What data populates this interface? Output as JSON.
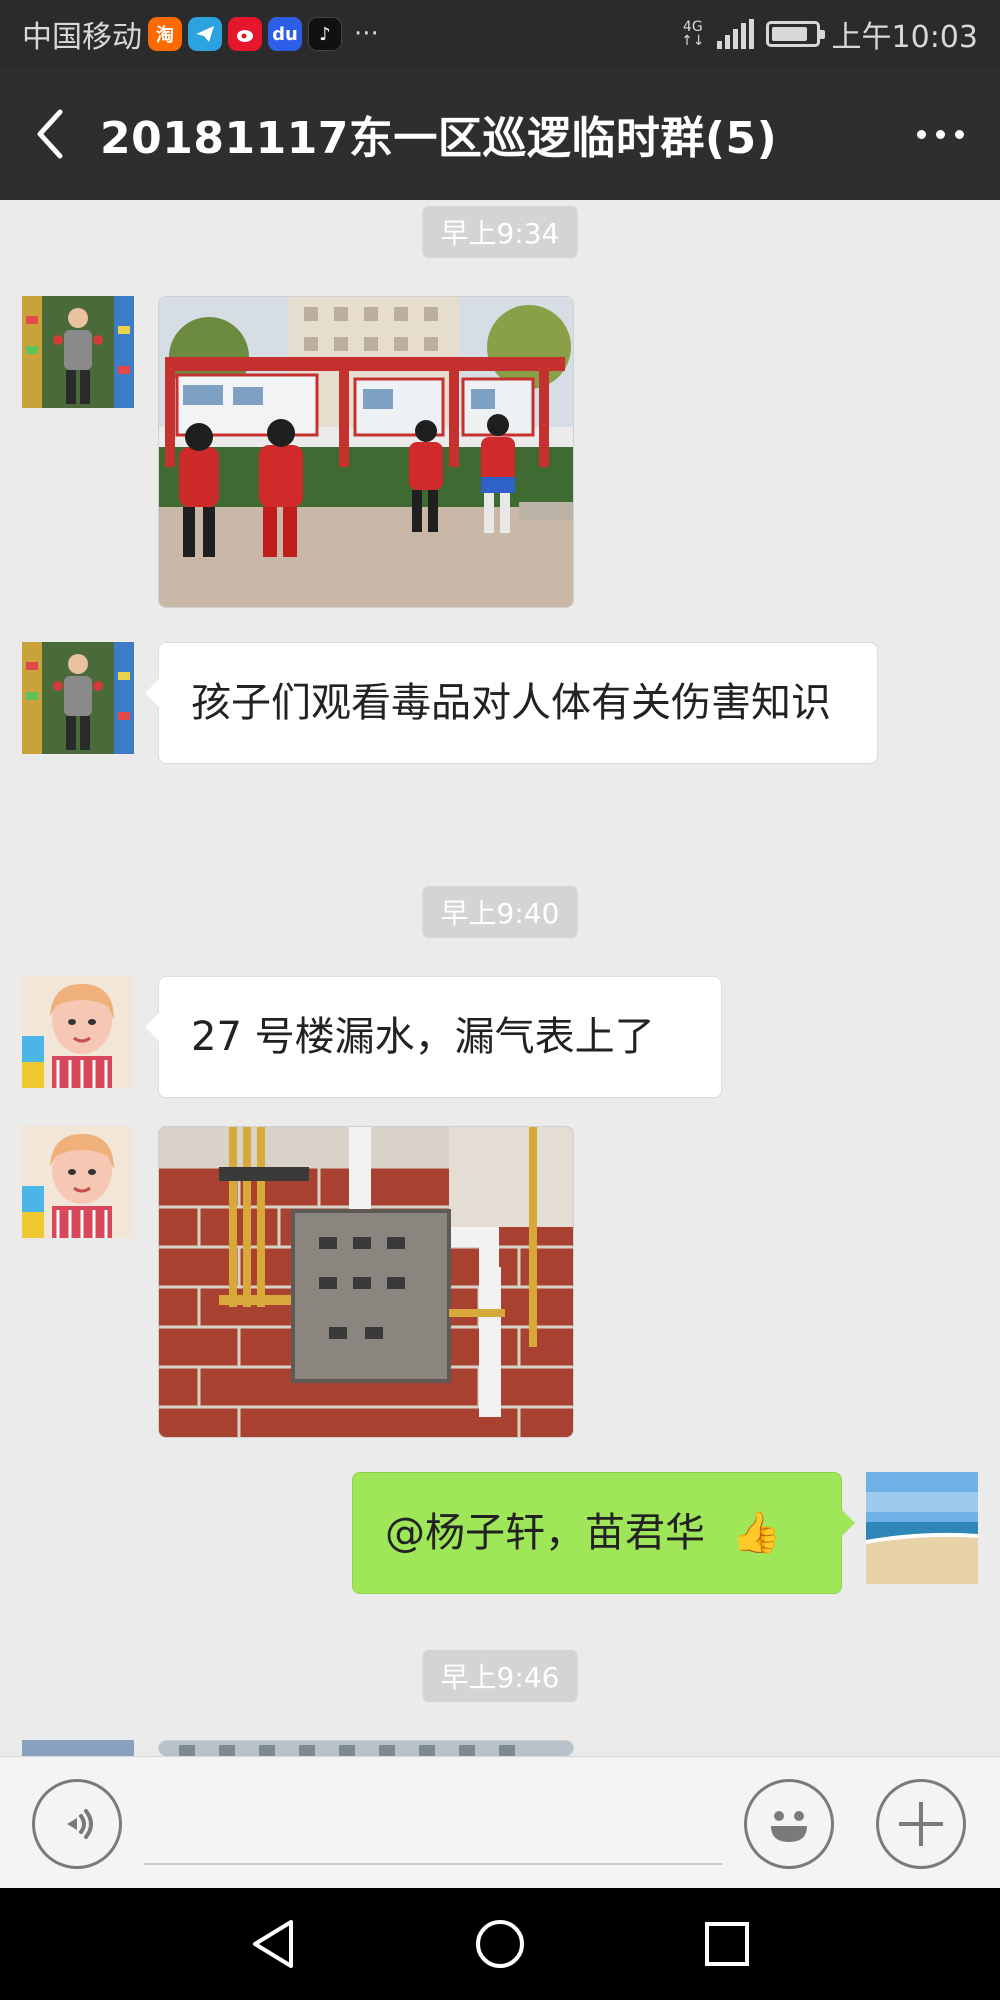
{
  "status_bar": {
    "carrier": "中国移动",
    "app_icons": [
      "taobao-icon",
      "telegram-icon",
      "weibo-icon",
      "baidu-icon",
      "tiktok-icon"
    ],
    "taobao_glyph": "淘",
    "baidu_glyph": "du",
    "tiktok_glyph": "♪",
    "overflow": "···",
    "net_type_top": "4G",
    "net_type_bottom": "↑↓",
    "time": "上午10:03"
  },
  "header": {
    "title": "20181117东一区巡逻临时群(5)"
  },
  "messages": {
    "ts1": "早上9:34",
    "msg2_text": "孩子们观看毒品对人体有关伤害知识",
    "ts2": "早上9:40",
    "msg3_text": "27 号楼漏水，漏气表上了",
    "msg5_text": "@杨子轩，苗君华",
    "msg5_emoji": "👍",
    "ts3": "早上9:46"
  },
  "colors": {
    "header_bg": "#2e2e2e",
    "chat_bg": "#ebebeb",
    "sent_bubble": "#9fe658",
    "received_bubble": "#ffffff"
  }
}
